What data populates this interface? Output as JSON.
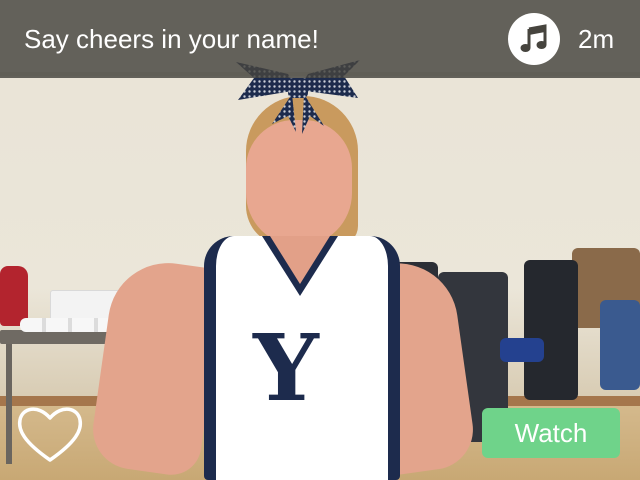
{
  "header": {
    "prompt_text": "Say cheers in your name!",
    "music_icon": "music-note-icon",
    "elapsed_time": "2m"
  },
  "actions": {
    "like_icon": "heart-outline-icon",
    "watch_label": "Watch"
  },
  "photo": {
    "uniform_letter": "Y"
  },
  "colors": {
    "overlay_bar": "#46443e",
    "watch_button": "#6fd38a",
    "icon_white": "#ffffff",
    "uniform_navy": "#1d2b4d"
  }
}
